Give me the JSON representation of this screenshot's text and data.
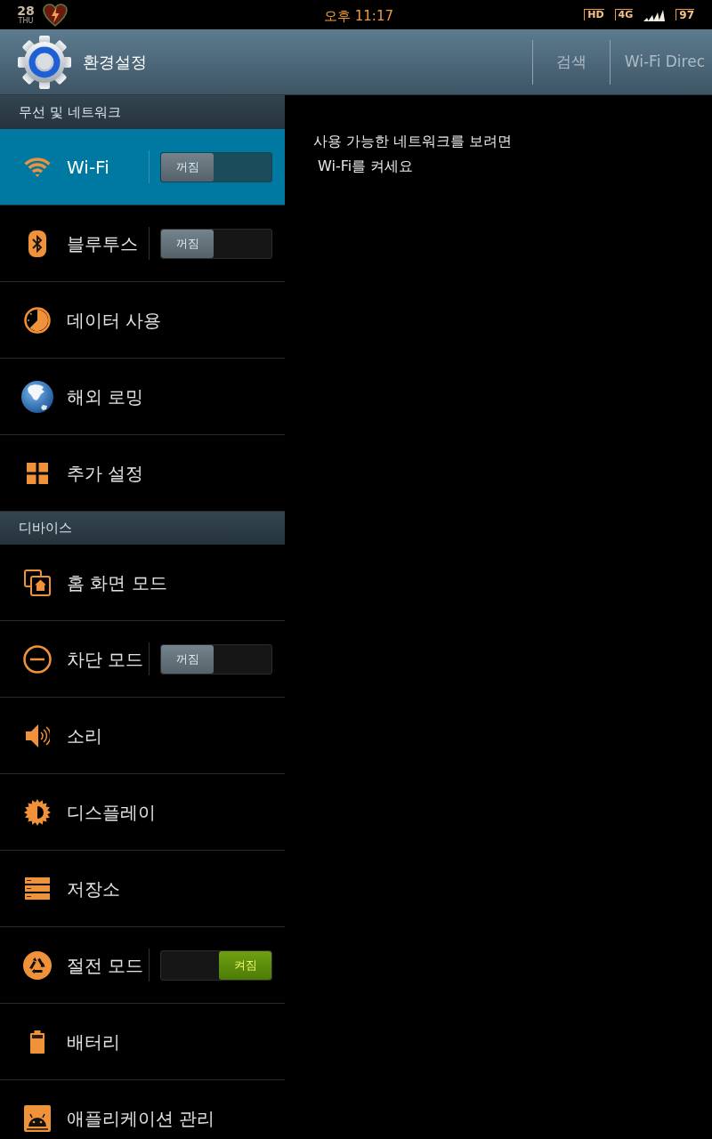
{
  "status_bar": {
    "date": "28",
    "weekday": "THU",
    "time": "오후 11:17",
    "indicators": [
      "HD",
      "4G"
    ],
    "battery": "97"
  },
  "action_bar": {
    "title": "환경설정",
    "actions": [
      "검색",
      "Wi-Fi Direc"
    ]
  },
  "sections": [
    {
      "header": "무선 및 네트워크",
      "items": [
        {
          "label": "Wi-Fi",
          "selected": true,
          "toggle": {
            "on": false,
            "label": "꺼짐"
          }
        },
        {
          "label": "블루투스",
          "selected": false,
          "toggle": {
            "on": false,
            "label": "꺼짐"
          }
        },
        {
          "label": "데이터 사용",
          "selected": false
        },
        {
          "label": "해외 로밍",
          "selected": false
        },
        {
          "label": "추가 설정",
          "selected": false
        }
      ]
    },
    {
      "header": "디바이스",
      "items": [
        {
          "label": "홈 화면 모드",
          "selected": false
        },
        {
          "label": "차단 모드",
          "selected": false,
          "toggle": {
            "on": false,
            "label": "꺼짐"
          }
        },
        {
          "label": "소리",
          "selected": false
        },
        {
          "label": "디스플레이",
          "selected": false
        },
        {
          "label": "저장소",
          "selected": false
        },
        {
          "label": "절전 모드",
          "selected": false,
          "toggle": {
            "on": true,
            "label": "켜짐"
          }
        },
        {
          "label": "배터리",
          "selected": false
        },
        {
          "label": "애플리케이션 관리",
          "selected": false
        }
      ]
    }
  ],
  "detail": {
    "message": "사용 가능한 네트워크를 보려면\n Wi-Fi를 켜세요"
  }
}
